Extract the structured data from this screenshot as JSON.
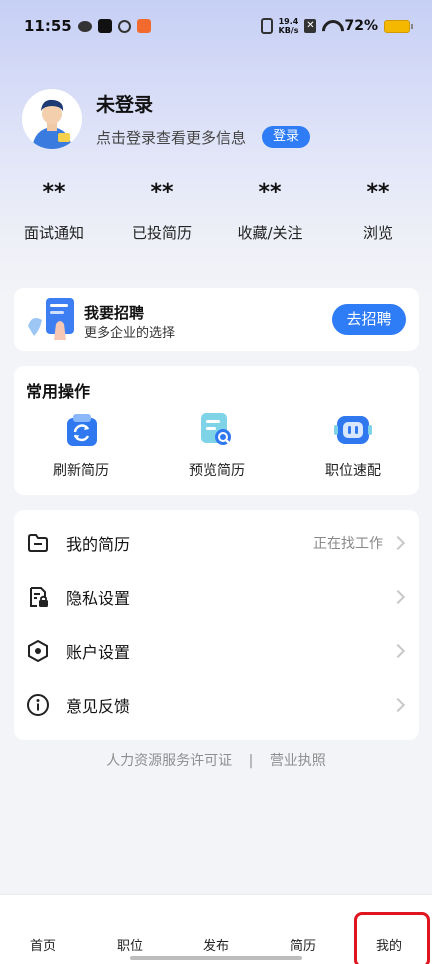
{
  "status_bar": {
    "time": "11:55",
    "notif_icons": [
      "wechat-icon",
      "tiktok-icon",
      "link-icon",
      "app-icon"
    ],
    "net_speed_top": "19.4",
    "net_speed_bottom": "KB/s",
    "battery": "72%"
  },
  "profile": {
    "title": "未登录",
    "subtitle": "点击登录查看更多信息",
    "login_button": "登录"
  },
  "stats": [
    {
      "value": "**",
      "label": "面试通知"
    },
    {
      "value": "**",
      "label": "已投简历"
    },
    {
      "value": "**",
      "label": "收藏/关注"
    },
    {
      "value": "**",
      "label": "浏览"
    }
  ],
  "recruit": {
    "title": "我要招聘",
    "subtitle": "更多企业的选择",
    "button": "去招聘"
  },
  "common_ops": {
    "title": "常用操作",
    "items": [
      {
        "label": "刷新简历",
        "icon": "refresh-resume-icon"
      },
      {
        "label": "预览简历",
        "icon": "preview-resume-icon"
      },
      {
        "label": "职位速配",
        "icon": "robot-match-icon"
      }
    ]
  },
  "menu": [
    {
      "label": "我的简历",
      "status": "正在找工作",
      "icon": "folder-icon"
    },
    {
      "label": "隐私设置",
      "status": "",
      "icon": "lock-document-icon"
    },
    {
      "label": "账户设置",
      "status": "",
      "icon": "hexagon-settings-icon"
    },
    {
      "label": "意见反馈",
      "status": "",
      "icon": "info-icon"
    }
  ],
  "footer_links": {
    "license": "人力资源服务许可证",
    "separator": "|",
    "business": "营业执照"
  },
  "tabs": [
    {
      "label": "首页"
    },
    {
      "label": "职位"
    },
    {
      "label": "发布"
    },
    {
      "label": "简历"
    },
    {
      "label": "我的"
    }
  ],
  "colors": {
    "accent": "#2e7cf6",
    "highlight_frame": "#e1151d"
  }
}
